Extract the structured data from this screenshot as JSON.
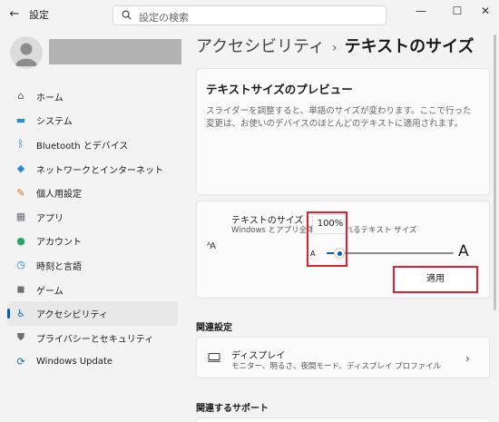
{
  "window": {
    "back_glyph": "←",
    "title": "設定",
    "controls": {
      "minimize": "—",
      "maximize": "☐",
      "close": "✕"
    }
  },
  "search": {
    "placeholder": "設定の検索",
    "icon": "search-icon"
  },
  "sidebar": {
    "items": [
      {
        "label": "ホーム",
        "icon": "home-icon",
        "glyph": "⌂",
        "color": "#555555"
      },
      {
        "label": "システム",
        "icon": "system-icon",
        "glyph": "▬",
        "color": "#1f8fd6"
      },
      {
        "label": "Bluetooth とデバイス",
        "icon": "bluetooth-icon",
        "glyph": "ᛒ",
        "color": "#0067c0"
      },
      {
        "label": "ネットワークとインターネット",
        "icon": "network-icon",
        "glyph": "◆",
        "color": "#2b88d8"
      },
      {
        "label": "個人用設定",
        "icon": "personalization-icon",
        "glyph": "✎",
        "color": "#d86c1a"
      },
      {
        "label": "アプリ",
        "icon": "apps-icon",
        "glyph": "▦",
        "color": "#6b6b7b"
      },
      {
        "label": "アカウント",
        "icon": "account-icon",
        "glyph": "●",
        "color": "#2ba36b"
      },
      {
        "label": "時刻と言語",
        "icon": "time-language-icon",
        "glyph": "◷",
        "color": "#1f7fc0"
      },
      {
        "label": "ゲーム",
        "icon": "gaming-icon",
        "glyph": "◼",
        "color": "#707070"
      },
      {
        "label": "アクセシビリティ",
        "icon": "accessibility-icon",
        "glyph": "♿",
        "color": "#0b6ec5",
        "active": true
      },
      {
        "label": "プライバシーとセキュリティ",
        "icon": "privacy-shield-icon",
        "glyph": "⛊",
        "color": "#707070"
      },
      {
        "label": "Windows Update",
        "icon": "windows-update-icon",
        "glyph": "⟳",
        "color": "#0f6cbd"
      }
    ]
  },
  "breadcrumb": {
    "parent": "アクセシビリティ",
    "separator": "›",
    "current": "テキストのサイズ"
  },
  "preview": {
    "title": "テキストサイズのプレビュー",
    "text": "スライダーを調整すると、単語のサイズが変わります。ここで行った変更は、お使いのデバイスのほとんどのテキストに適用されます。"
  },
  "text_size": {
    "label": "テキストのサイズ",
    "description": "Windows とアプリ全体に表示されるテキスト サイズ",
    "value_label": "100%",
    "slider_fraction": 0.1,
    "small_a": "A",
    "big_a": "A",
    "aa_glyph": "ᴬA",
    "apply_label": "適用"
  },
  "related_settings": {
    "title": "関連設定",
    "display": {
      "title": "ディスプレイ",
      "description": "モニター、明るさ、夜間モード、ディスプレイ プロファイル",
      "chevron": "›"
    }
  },
  "related_support": {
    "title": "関連するサポート"
  },
  "colors": {
    "accent": "#005fb8",
    "highlight": "#e0202a"
  }
}
